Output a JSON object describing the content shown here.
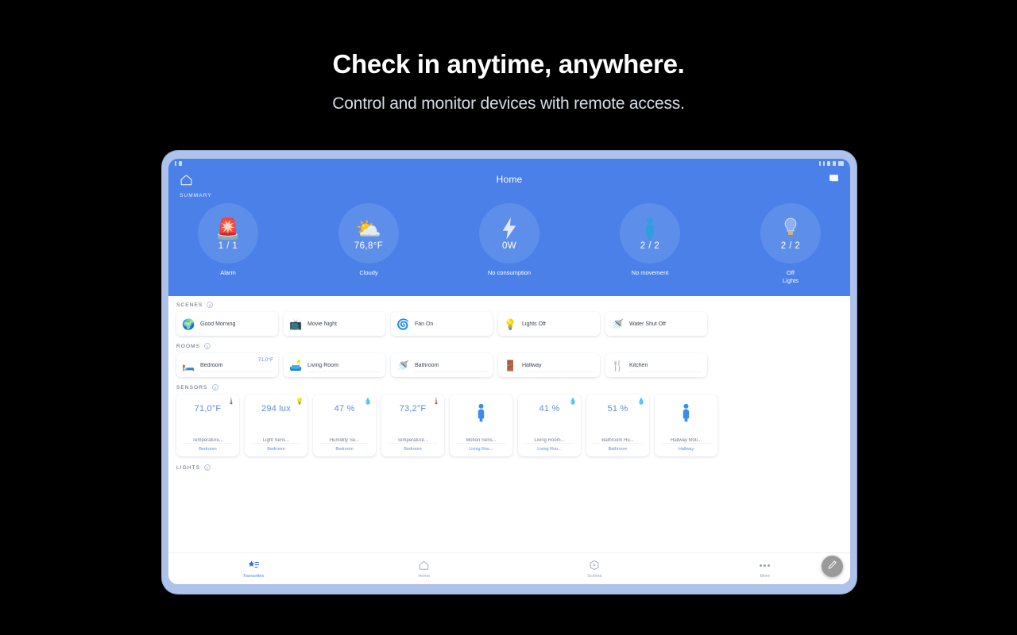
{
  "promo": {
    "headline": "Check in anytime, anywhere.",
    "subhead": "Control and monitor devices with remote access."
  },
  "colors": {
    "accent": "#4a80e8",
    "bezel": "#aec2ea",
    "background": "#000000",
    "card": "#ffffff",
    "sensor_value": "#5b8ce8"
  },
  "app": {
    "title": "Home",
    "home_icon": "home-outline-icon",
    "cast_icon": "cast-icon",
    "status_bar": {
      "left_icons": [
        "wifi-icon",
        "signal-icon"
      ],
      "right_icons": [
        "alarm-icon",
        "bluetooth-icon",
        "wifi-icon",
        "signal-icon",
        "battery-icon"
      ],
      "time": ""
    },
    "summary": {
      "label": "SUMMARY",
      "items": [
        {
          "icon": "alarm-light-icon",
          "emoji": "🚨",
          "value": "1 / 1",
          "label": "Alarm"
        },
        {
          "icon": "partly-cloudy-icon",
          "emoji": "⛅",
          "value": "76,8°F",
          "label": "Cloudy"
        },
        {
          "icon": "lightning-bolt-icon",
          "emoji": "",
          "value": "0W",
          "label": "No consumption"
        },
        {
          "icon": "person-icon",
          "emoji": "",
          "value": "2 / 2",
          "label": "No movement"
        },
        {
          "icon": "light-bulb-icon",
          "emoji": "",
          "value": "2 / 2",
          "label": "Off\nLights"
        }
      ]
    },
    "scenes": {
      "label": "SCENES",
      "info_icon": "info-icon",
      "items": [
        {
          "emoji": "🌍",
          "icon": "globe-icon",
          "label": "Good Morning"
        },
        {
          "emoji": "📺",
          "icon": "tv-icon",
          "label": "Movie Night"
        },
        {
          "emoji": "🌀",
          "icon": "fan-icon",
          "label": "Fan On"
        },
        {
          "emoji": "💡",
          "icon": "bulb-icon",
          "label": "Lights Off"
        },
        {
          "emoji": "🚿",
          "icon": "shower-icon",
          "label": "Water Shut Off"
        }
      ]
    },
    "rooms": {
      "label": "ROOMS",
      "info_icon": "info-icon",
      "items": [
        {
          "emoji": "🛏️",
          "icon": "bed-icon",
          "label": "Bedroom",
          "badge": "71,0°F"
        },
        {
          "emoji": "🛋️",
          "icon": "sofa-icon",
          "label": "Living Room",
          "badge": ""
        },
        {
          "emoji": "🚿",
          "icon": "shower-icon",
          "label": "Bathroom",
          "badge": ""
        },
        {
          "emoji": "🚪",
          "icon": "door-icon",
          "label": "Hallway",
          "badge": ""
        },
        {
          "emoji": "🍴",
          "icon": "kitchen-icon",
          "label": "Kitchen",
          "badge": ""
        }
      ]
    },
    "sensors": {
      "label": "SENSORS",
      "info_icon": "info-icon",
      "items": [
        {
          "corner_icon": "thermometer-green-icon",
          "corner_emoji": "🌡️",
          "value": "71,0°F",
          "name": "Temperature...",
          "room": "Bedroom",
          "kind": "value"
        },
        {
          "corner_icon": "light-bulb-icon",
          "corner_emoji": "💡",
          "value": "294 lux",
          "name": "Light Sens...",
          "room": "Bedroom",
          "kind": "value"
        },
        {
          "corner_icon": "humidity-icon",
          "corner_emoji": "💧",
          "value": "47 %",
          "name": "Humidity Se...",
          "room": "Bedroom",
          "kind": "value"
        },
        {
          "corner_icon": "thermometer-red-icon",
          "corner_emoji": "🌡️",
          "value": "73,2°F",
          "name": "Temperature...",
          "room": "Bedroom",
          "kind": "value"
        },
        {
          "corner_icon": "",
          "corner_emoji": "",
          "value": "",
          "name": "Motion Sens...",
          "room": "Living Roo...",
          "kind": "person"
        },
        {
          "corner_icon": "humidity-icon",
          "corner_emoji": "💧",
          "value": "41 %",
          "name": "Living Room...",
          "room": "Living Roo...",
          "kind": "value"
        },
        {
          "corner_icon": "humidity-icon",
          "corner_emoji": "💧",
          "value": "51 %",
          "name": "Bathroom Hu...",
          "room": "Bathroom",
          "kind": "value"
        },
        {
          "corner_icon": "",
          "corner_emoji": "",
          "value": "",
          "name": "Hallway Moti...",
          "room": "Hallway",
          "kind": "person"
        }
      ]
    },
    "lights": {
      "label": "LIGHTS",
      "info_icon": "info-icon"
    },
    "bottom_nav": {
      "items": [
        {
          "icon": "star-favourites-icon",
          "label": "Favourites",
          "active": true
        },
        {
          "icon": "home-icon",
          "label": "Home",
          "active": false
        },
        {
          "icon": "scenes-play-icon",
          "label": "Scenes",
          "active": false
        },
        {
          "icon": "more-dots-icon",
          "label": "More",
          "active": false
        }
      ],
      "fab": {
        "icon": "edit-pencil-icon",
        "label": ""
      }
    }
  }
}
